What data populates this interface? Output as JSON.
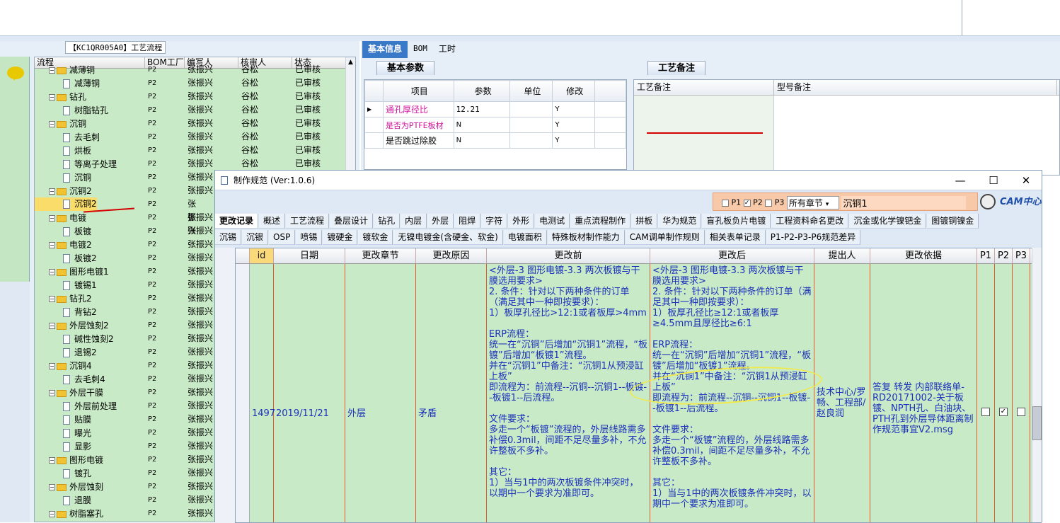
{
  "app": {
    "flow_title": "【KC1QR005A0】工艺流程"
  },
  "tree": {
    "headers": [
      "流程",
      "BOM工厂",
      "编写人",
      "核审人",
      "状态"
    ],
    "rows": [
      {
        "depth": 1,
        "type": "folder",
        "name": "减薄铜",
        "bom": "P2",
        "writer": "张振兴",
        "reviewer": "谷松",
        "status": "已审核"
      },
      {
        "depth": 2,
        "type": "doc",
        "name": "减薄铜",
        "bom": "P2",
        "writer": "张振兴",
        "reviewer": "谷松",
        "status": "已审核"
      },
      {
        "depth": 1,
        "type": "folder",
        "name": "钻孔",
        "bom": "P2",
        "writer": "张振兴",
        "reviewer": "谷松",
        "status": "已审核"
      },
      {
        "depth": 2,
        "type": "doc",
        "name": "树脂钻孔",
        "bom": "P2",
        "writer": "张振兴",
        "reviewer": "谷松",
        "status": "已审核"
      },
      {
        "depth": 1,
        "type": "folder",
        "name": "沉铜",
        "bom": "P2",
        "writer": "张振兴",
        "reviewer": "谷松",
        "status": "已审核"
      },
      {
        "depth": 2,
        "type": "doc",
        "name": "去毛刺",
        "bom": "P2",
        "writer": "张振兴",
        "reviewer": "谷松",
        "status": "已审核"
      },
      {
        "depth": 2,
        "type": "doc",
        "name": "烘板",
        "bom": "P2",
        "writer": "张振兴",
        "reviewer": "谷松",
        "status": "已审核"
      },
      {
        "depth": 2,
        "type": "doc",
        "name": "等离子处理",
        "bom": "P2",
        "writer": "张振兴",
        "reviewer": "谷松",
        "status": "已审核"
      },
      {
        "depth": 2,
        "type": "doc",
        "name": "沉铜",
        "bom": "P2",
        "writer": "张振兴",
        "reviewer": "",
        "status": ""
      },
      {
        "depth": 1,
        "type": "folder",
        "name": "沉铜2",
        "bom": "P2",
        "writer": "张振兴",
        "reviewer": "",
        "status": ""
      },
      {
        "depth": 2,
        "type": "doc",
        "name": "沉铜2",
        "bom": "P2",
        "writer": "张振兴",
        "reviewer": "",
        "status": "",
        "selected": true
      },
      {
        "depth": 1,
        "type": "folder",
        "name": "电镀",
        "bom": "P2",
        "writer": "张振兴",
        "reviewer": "",
        "status": ""
      },
      {
        "depth": 2,
        "type": "doc",
        "name": "板镀",
        "bom": "P2",
        "writer": "张振兴",
        "reviewer": "",
        "status": ""
      },
      {
        "depth": 1,
        "type": "folder",
        "name": "电镀2",
        "bom": "P2",
        "writer": "张振兴",
        "reviewer": "",
        "status": ""
      },
      {
        "depth": 2,
        "type": "doc",
        "name": "板镀2",
        "bom": "P2",
        "writer": "张振兴",
        "reviewer": "",
        "status": ""
      },
      {
        "depth": 1,
        "type": "folder",
        "name": "图形电镀1",
        "bom": "P2",
        "writer": "张振兴",
        "reviewer": "",
        "status": ""
      },
      {
        "depth": 2,
        "type": "doc",
        "name": "镀锡1",
        "bom": "P2",
        "writer": "张振兴",
        "reviewer": "",
        "status": ""
      },
      {
        "depth": 1,
        "type": "folder",
        "name": "钻孔2",
        "bom": "P2",
        "writer": "张振兴",
        "reviewer": "",
        "status": ""
      },
      {
        "depth": 2,
        "type": "doc",
        "name": "背钻2",
        "bom": "P2",
        "writer": "张振兴",
        "reviewer": "",
        "status": ""
      },
      {
        "depth": 1,
        "type": "folder",
        "name": "外层蚀刻2",
        "bom": "P2",
        "writer": "张振兴",
        "reviewer": "",
        "status": ""
      },
      {
        "depth": 2,
        "type": "doc",
        "name": "碱性蚀刻2",
        "bom": "P2",
        "writer": "张振兴",
        "reviewer": "",
        "status": ""
      },
      {
        "depth": 2,
        "type": "doc",
        "name": "退锡2",
        "bom": "P2",
        "writer": "张振兴",
        "reviewer": "",
        "status": ""
      },
      {
        "depth": 1,
        "type": "folder",
        "name": "沉铜4",
        "bom": "P2",
        "writer": "张振兴",
        "reviewer": "",
        "status": ""
      },
      {
        "depth": 2,
        "type": "doc",
        "name": "去毛刺4",
        "bom": "P2",
        "writer": "张振兴",
        "reviewer": "",
        "status": ""
      },
      {
        "depth": 1,
        "type": "folder",
        "name": "外层干膜",
        "bom": "P2",
        "writer": "张振兴",
        "reviewer": "",
        "status": ""
      },
      {
        "depth": 2,
        "type": "doc",
        "name": "外层前处理",
        "bom": "P2",
        "writer": "张振兴",
        "reviewer": "",
        "status": ""
      },
      {
        "depth": 2,
        "type": "doc",
        "name": "贴膜",
        "bom": "P2",
        "writer": "张振兴",
        "reviewer": "",
        "status": ""
      },
      {
        "depth": 2,
        "type": "doc",
        "name": "曝光",
        "bom": "P2",
        "writer": "张振兴",
        "reviewer": "",
        "status": ""
      },
      {
        "depth": 2,
        "type": "doc",
        "name": "显影",
        "bom": "P2",
        "writer": "张振兴",
        "reviewer": "",
        "status": ""
      },
      {
        "depth": 1,
        "type": "folder",
        "name": "图形电镀",
        "bom": "P2",
        "writer": "张振兴",
        "reviewer": "",
        "status": ""
      },
      {
        "depth": 2,
        "type": "doc",
        "name": "镀孔",
        "bom": "P2",
        "writer": "张振兴",
        "reviewer": "",
        "status": ""
      },
      {
        "depth": 1,
        "type": "folder",
        "name": "外层蚀刻",
        "bom": "P2",
        "writer": "张振兴",
        "reviewer": "",
        "status": ""
      },
      {
        "depth": 2,
        "type": "doc",
        "name": "退膜",
        "bom": "P2",
        "writer": "张振兴",
        "reviewer": "",
        "status": ""
      },
      {
        "depth": 1,
        "type": "folder",
        "name": "树脂塞孔",
        "bom": "P2",
        "writer": "张振兴",
        "reviewer": "",
        "status": ""
      }
    ]
  },
  "right": {
    "tabs": [
      "基本信息",
      "BOM",
      "工时"
    ],
    "basic_tab": "基本参数",
    "param_headers": [
      "项目",
      "参数",
      "单位",
      "修改"
    ],
    "params": [
      {
        "item": "通孔厚径比",
        "value": "12.21",
        "unit": "",
        "mod": "Y"
      },
      {
        "item": "是否为PTFE板材",
        "value": "N",
        "unit": "",
        "mod": "Y"
      },
      {
        "item": "是否跳过除胶",
        "value": "N",
        "unit": "",
        "mod": "Y"
      }
    ],
    "note_tab": "工艺备注",
    "note_headers": [
      "工艺备注",
      "型号备注"
    ]
  },
  "dialog": {
    "title": "制作规范 (Ver:1.0.6)",
    "filters": {
      "p1": "P1",
      "p2": "P2",
      "p3": "P3",
      "chapter": "所有章节",
      "search": "沉铜1",
      "logo": "CAM中心"
    },
    "tabs_row1": [
      "更改记录",
      "概述",
      "工艺流程",
      "叠层设计",
      "钻孔",
      "内层",
      "外层",
      "阻焊",
      "字符",
      "外形",
      "电测试",
      "重点流程制作",
      "拼板",
      "华为规范",
      "盲孔板负片电镀",
      "工程资料命名更改",
      "沉金或化学镍钯金",
      "图镀铜镍金"
    ],
    "tabs_row2": [
      "沉锡",
      "沉银",
      "OSP",
      "喷锡",
      "镀硬金",
      "镀软金",
      "无镍电镀金(含硬金、软金)",
      "电镀面积",
      "特殊板材制作能力",
      "CAM调单制作规则",
      "相关表单记录",
      "P1-P2-P3-P6规范差异"
    ],
    "headers": [
      "id",
      "日期",
      "更改章节",
      "更改原因",
      "更改前",
      "更改后",
      "提出人",
      "更改依据",
      "P1",
      "P2",
      "P3"
    ],
    "record": {
      "id": "1497",
      "date": "2019/11/21",
      "chapter": "外层",
      "reason": "矛盾",
      "before": "<外层-3 图形电镀-3.3 两次板镀与干膜选用要求>\n2. 条件：针对以下两种条件的订单（满足其中一种即按要求）：\n1）板厚孔径比>12:1或者板厚>4mm\n\nERP流程：\n统一在“沉铜”后增加“沉铜1”流程，“板镀”后增加“板镀1”流程。\n并在“沉铜1”中备注：“沉铜1从预浸缸上板”\n即流程为：前流程--沉铜--沉铜1--板镀--板镀1--后流程。\n\n文件要求：\n多走一个“板镀”流程的，外层线路需多补偿0.3mil，间距不足尽量多补，不允许整板不多补。\n\n其它：\n1）当与1中的两次板镀条件冲突时，以期中一个要求为准即可。",
      "after": "<外层-3 图形电镀-3.3 两次板镀与干膜选用要求>\n2. 条件：针对以下两种条件的订单（满足其中一种即按要求）：\n1）板厚孔径比≥12:1或者板厚≥4.5mm且厚径比≥6:1\n\nERP流程：\n统一在“沉铜”后增加“沉铜1”流程，“板镀”后增加“板镀1”流程。\n并在“沉铜1”中备注：“沉铜1从预浸缸上板”\n即流程为：前流程--沉铜--沉铜1--板镀--板镀1--后流程。\n\n文件要求：\n多走一个“板镀”流程的，外层线路需多补偿0.3mil，间距不足尽量多补，不允许整板不多补。\n\n其它：\n1）当与1中的两次板镀条件冲突时，以期中一个要求为准即可。",
      "proposer": "技术中心/罗畅、工程部/赵良润",
      "basis": "答复 转发 内部联络单-RD20171002-关于板镀、NPTH孔、白油块、PTH孔到外层导体距离制作规范事宜V2.msg",
      "p1": false,
      "p2": true,
      "p3": false
    }
  },
  "colors": {
    "tree_bg": "#c8eac6",
    "accent_blue": "#3a78c8",
    "text_blue": "#1a2fbb",
    "pink": "#d0149c",
    "highlight": "#f9dc6a"
  }
}
